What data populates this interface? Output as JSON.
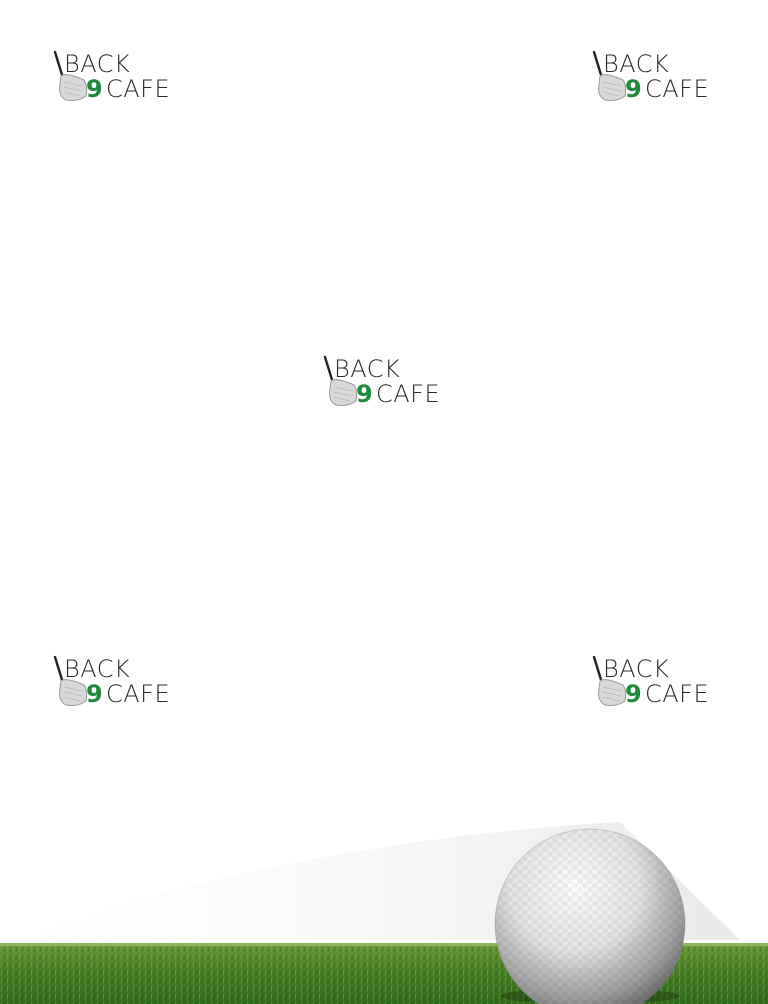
{
  "brand": {
    "line1": "BACK",
    "number": "9",
    "line2": "CAFE",
    "number_color": "#1f8a3c",
    "text_color": "#2a2a2a"
  },
  "logos": [
    {
      "id": "top-left"
    },
    {
      "id": "top-right"
    },
    {
      "id": "center"
    },
    {
      "id": "bottom-left"
    },
    {
      "id": "bottom-right"
    }
  ],
  "decor": {
    "ball": "golf-ball-icon",
    "grass": "grass-strip",
    "grass_color": "#3f7a22",
    "ball_color": "#e8e8e8"
  }
}
